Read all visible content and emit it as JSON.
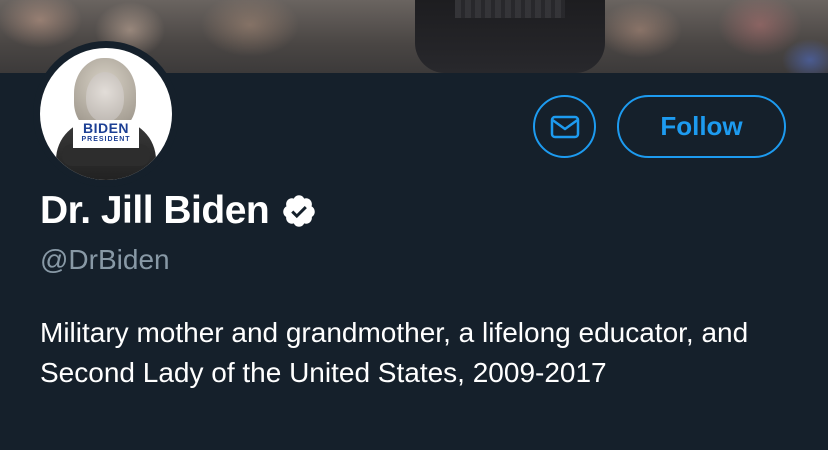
{
  "profile": {
    "display_name": "Dr. Jill Biden",
    "handle": "@DrBiden",
    "bio": "Military mother and grandmother, a lifelong educator, and Second Lady of the United States, 2009-2017",
    "verified_icon": "verified-badge-icon",
    "avatar_logo_main": "BIDEN",
    "avatar_logo_sub": "PRESIDENT"
  },
  "actions": {
    "follow_label": "Follow",
    "message_icon": "envelope-icon"
  },
  "colors": {
    "background": "#15202b",
    "accent": "#1d9bf0",
    "text_primary": "#ffffff",
    "text_secondary": "#8899a6"
  }
}
